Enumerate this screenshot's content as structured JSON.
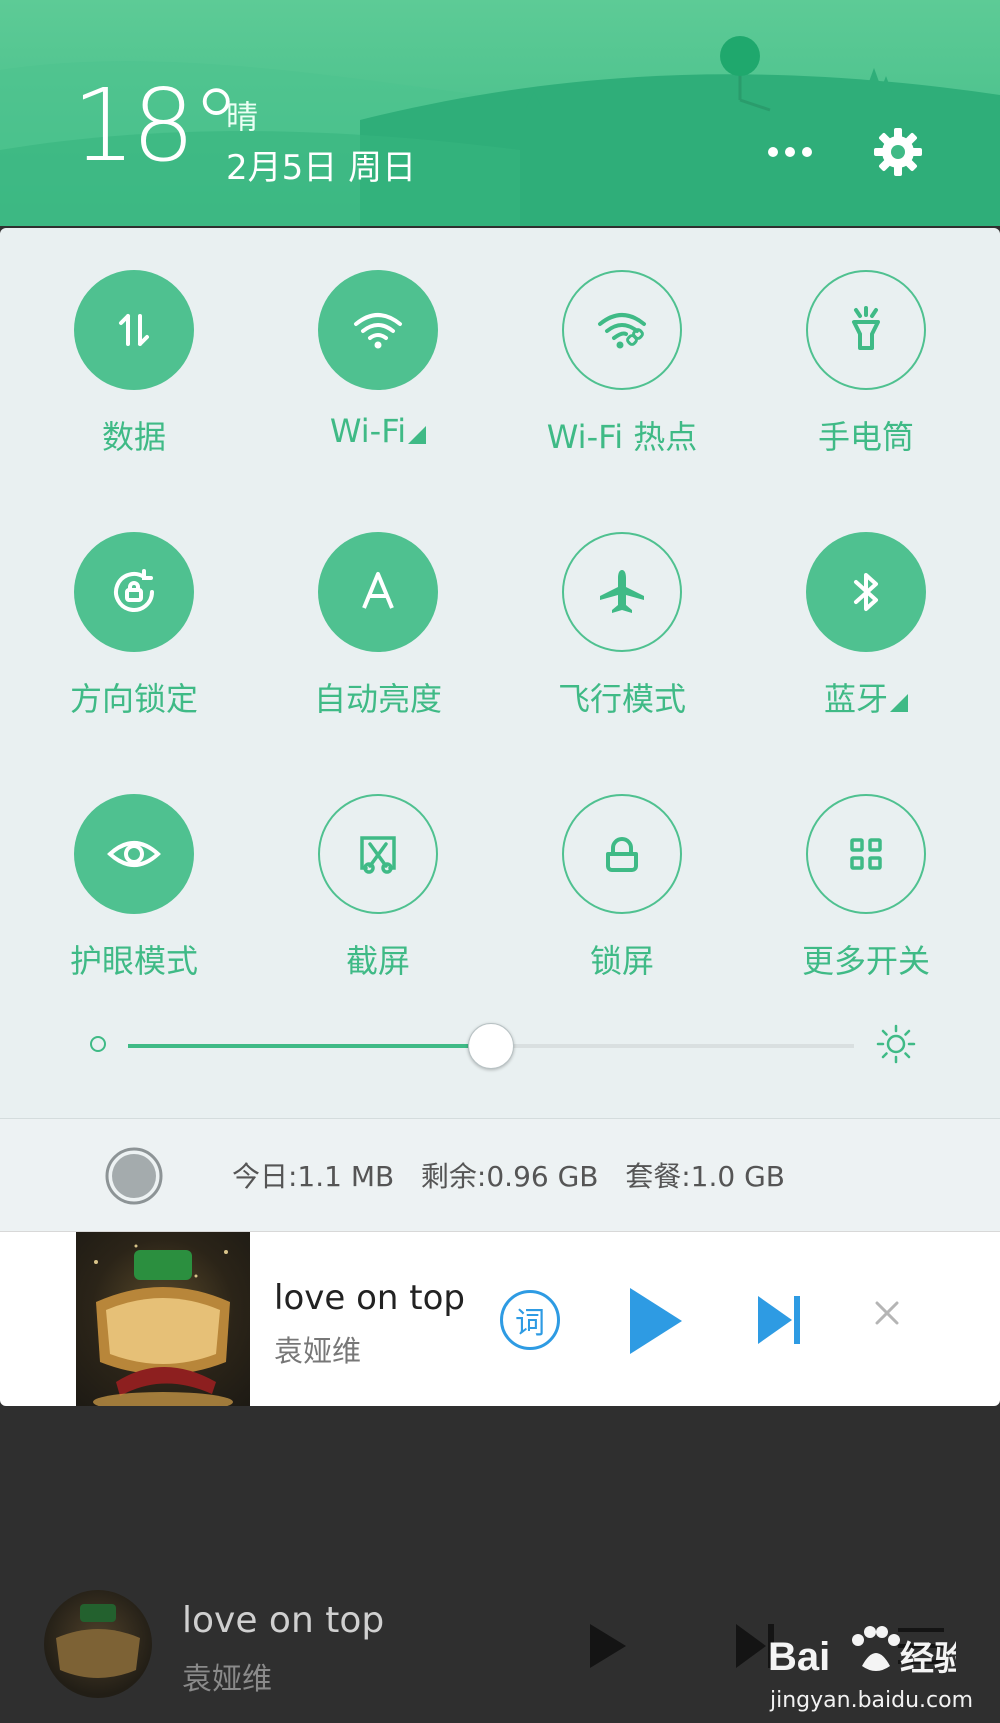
{
  "header": {
    "temperature": "18°",
    "weather": "晴",
    "date": "2月5日 周日"
  },
  "quick_settings": {
    "tiles": [
      {
        "label": "数据",
        "icon": "mobile-data-icon",
        "active": true,
        "has_expand": false
      },
      {
        "label": "Wi-Fi",
        "icon": "wifi-icon",
        "active": true,
        "has_expand": true
      },
      {
        "label": "Wi-Fi 热点",
        "icon": "hotspot-icon",
        "active": false,
        "has_expand": false
      },
      {
        "label": "手电筒",
        "icon": "flashlight-icon",
        "active": false,
        "has_expand": false
      },
      {
        "label": "方向锁定",
        "icon": "rotation-lock-icon",
        "active": true,
        "has_expand": false
      },
      {
        "label": "自动亮度",
        "icon": "auto-brightness-icon",
        "active": true,
        "has_expand": false
      },
      {
        "label": "飞行模式",
        "icon": "airplane-icon",
        "active": false,
        "has_expand": false
      },
      {
        "label": "蓝牙",
        "icon": "bluetooth-icon",
        "active": true,
        "has_expand": true
      },
      {
        "label": "护眼模式",
        "icon": "eye-icon",
        "active": true,
        "has_expand": false
      },
      {
        "label": "截屏",
        "icon": "screenshot-icon",
        "active": false,
        "has_expand": false
      },
      {
        "label": "锁屏",
        "icon": "lock-icon",
        "active": false,
        "has_expand": false
      },
      {
        "label": "更多开关",
        "icon": "grid-icon",
        "active": false,
        "has_expand": false
      }
    ],
    "brightness_level": 0.5
  },
  "data_usage": {
    "text": "今日:1.1 MB   剩余:0.96 GB   套餐:1.0 GB"
  },
  "music_notification": {
    "title": "love on top",
    "artist": "袁娅维",
    "lyric_button": "词"
  },
  "background_player": {
    "title": "love on top",
    "artist": "袁娅维"
  },
  "watermark": {
    "brand": "Bai 经验",
    "url": "jingyan.baidu.com"
  },
  "colors": {
    "accent": "#3fba86",
    "tile_on": "#4fc190",
    "music_blue": "#2e9be3"
  }
}
